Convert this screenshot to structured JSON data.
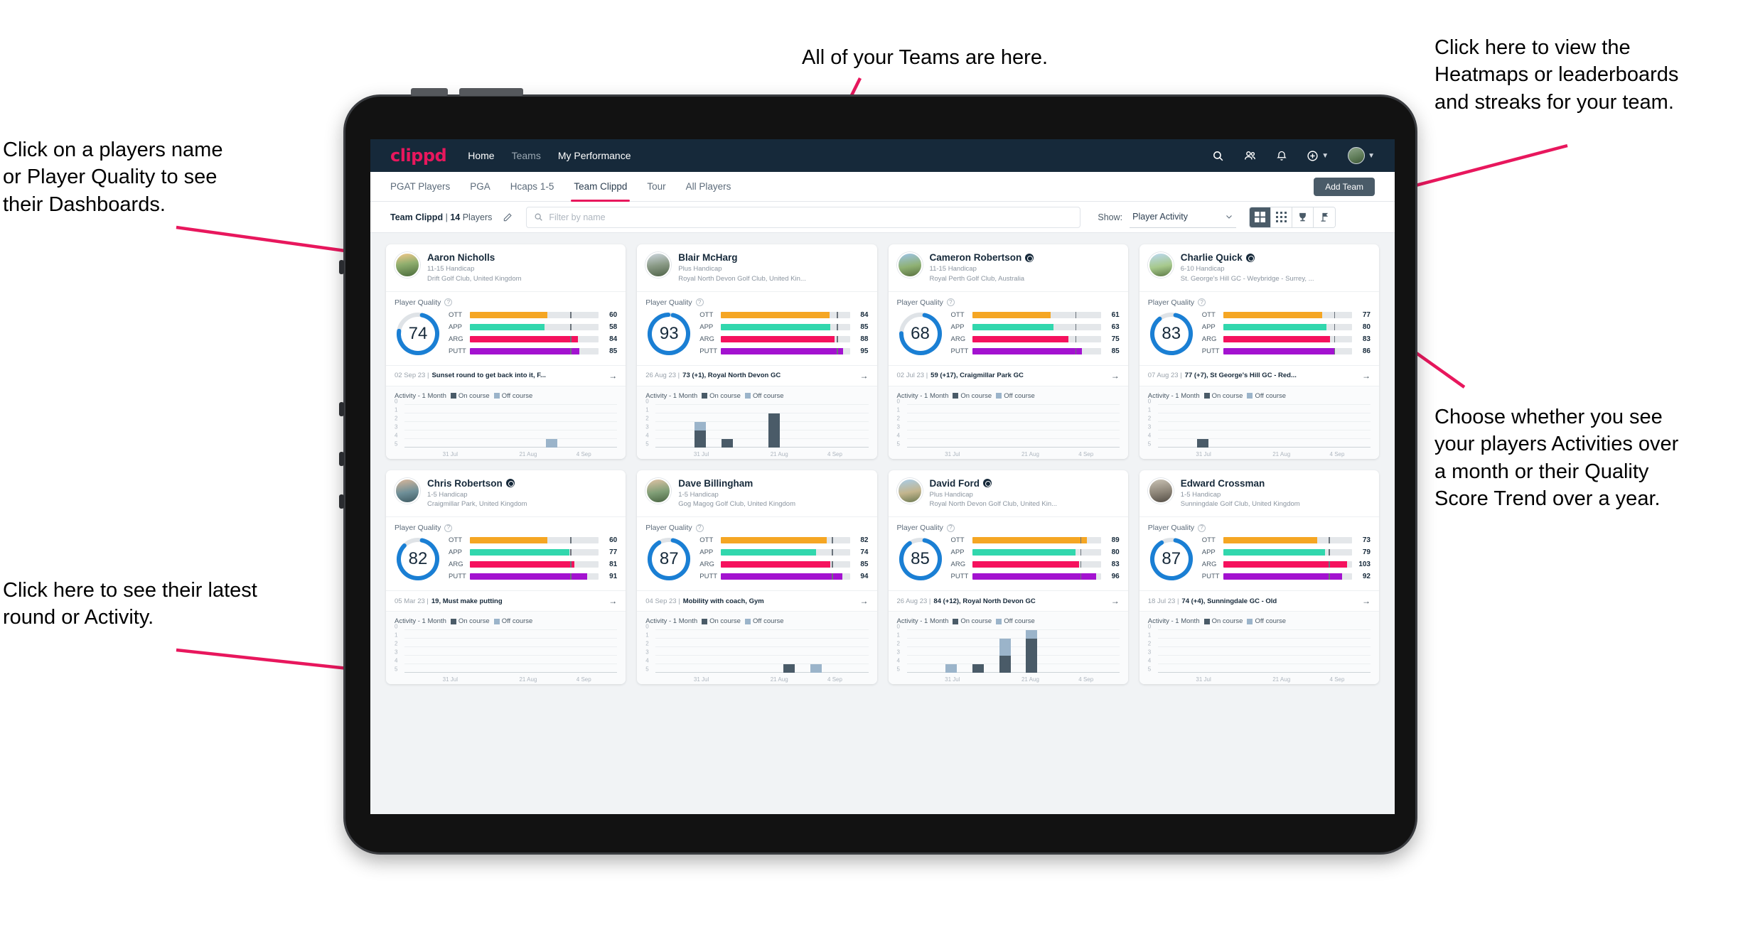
{
  "annotations": [
    {
      "id": "teams",
      "text": "All of your Teams are here."
    },
    {
      "id": "heatmaps",
      "text": "Click here to view the\nHeatmaps or leaderboards\nand streaks for your team."
    },
    {
      "id": "names",
      "text": "Click on a players name\nor Player Quality to see\ntheir Dashboards."
    },
    {
      "id": "activity",
      "text": "Choose whether you see\nyour players Activities over\na month or their Quality\nScore Trend over a year."
    },
    {
      "id": "latest",
      "text": "Click here to see their latest\nround or Activity."
    }
  ],
  "topnav": {
    "brand": "clippd",
    "links": [
      {
        "label": "Home",
        "active": true
      },
      {
        "label": "Teams",
        "active": false
      },
      {
        "label": "My Performance",
        "active": true
      }
    ],
    "icons": [
      "search-icon",
      "people-icon",
      "bell-icon",
      "plus-circle-icon",
      "avatar"
    ]
  },
  "subtabs": {
    "items": [
      {
        "label": "PGAT Players",
        "active": false
      },
      {
        "label": "PGA",
        "active": false
      },
      {
        "label": "Hcaps 1-5",
        "active": false
      },
      {
        "label": "Team Clippd",
        "active": true
      },
      {
        "label": "Tour",
        "active": false
      },
      {
        "label": "All Players",
        "active": false
      }
    ],
    "add_team_label": "Add Team"
  },
  "filterbar": {
    "team_name": "Team Clippd",
    "team_count": "14",
    "team_count_suffix": "Players",
    "separator": "|",
    "search_placeholder": "Filter by name",
    "show_label": "Show:",
    "show_value": "Player Activity",
    "view_modes": [
      "grid-large-icon",
      "grid-small-icon",
      "trophy-icon",
      "flag-icon"
    ],
    "active_view": "grid-large-icon"
  },
  "colors": {
    "accent_pink": "#e8175d",
    "nav_bg": "#16293a",
    "ott": "#f5a623",
    "app": "#31d7ad",
    "arg": "#f5125e",
    "putt": "#a312d0",
    "ring": "#1a7fd4",
    "on_course": "#4a5b68",
    "off_course": "#9bb4ca"
  },
  "chart_common": {
    "legend": [
      "On course",
      "Off course"
    ],
    "activity_title": "Activity - 1 Month",
    "yticks": [
      "5",
      "4",
      "3",
      "2",
      "1",
      "0"
    ],
    "ylim": [
      0,
      5
    ],
    "xticks": [
      "31 Jul",
      "21 Aug",
      "4 Sep"
    ]
  },
  "metric_labels": [
    "OTT",
    "APP",
    "ARG",
    "PUTT"
  ],
  "pq_label": "Player Quality",
  "players": [
    {
      "name": "Aaron Nicholls",
      "verified": false,
      "handicap": "11-15 Handicap",
      "club": "Drift Golf Club, United Kingdom",
      "quality": "74",
      "ring_pct": 74,
      "metrics": [
        {
          "label": "OTT",
          "value": "60",
          "fill": 60,
          "tick": 78
        },
        {
          "label": "APP",
          "value": "58",
          "fill": 58,
          "tick": 78
        },
        {
          "label": "ARG",
          "value": "84",
          "fill": 84,
          "tick": 78
        },
        {
          "label": "PUTT",
          "value": "85",
          "fill": 85,
          "tick": 78
        }
      ],
      "round_date": "02 Sep 23",
      "round_text": "Sunset round to get back into it, F...",
      "chart": {
        "type": "bar",
        "bars": [
          {
            "x": 68,
            "on": 0,
            "off": 1
          }
        ]
      }
    },
    {
      "name": "Blair McHarg",
      "verified": false,
      "handicap": "Plus Handicap",
      "club": "Royal North Devon Golf Club, United Kin...",
      "quality": "93",
      "ring_pct": 96,
      "metrics": [
        {
          "label": "OTT",
          "value": "84",
          "fill": 84,
          "tick": 90
        },
        {
          "label": "APP",
          "value": "85",
          "fill": 85,
          "tick": 90
        },
        {
          "label": "ARG",
          "value": "88",
          "fill": 88,
          "tick": 90
        },
        {
          "label": "PUTT",
          "value": "95",
          "fill": 95,
          "tick": 90
        }
      ],
      "round_date": "26 Aug 23",
      "round_text": "73 (+1), Royal North Devon GC",
      "chart": {
        "type": "bar",
        "bars": [
          {
            "x": 22,
            "on": 2,
            "off": 1
          },
          {
            "x": 34,
            "on": 1,
            "off": 0
          },
          {
            "x": 55,
            "on": 4,
            "off": 0
          }
        ]
      }
    },
    {
      "name": "Cameron Robertson",
      "verified": true,
      "handicap": "11-15 Handicap",
      "club": "Royal Perth Golf Club, Australia",
      "quality": "68",
      "ring_pct": 72,
      "metrics": [
        {
          "label": "OTT",
          "value": "61",
          "fill": 61,
          "tick": 80
        },
        {
          "label": "APP",
          "value": "63",
          "fill": 63,
          "tick": 80
        },
        {
          "label": "ARG",
          "value": "75",
          "fill": 75,
          "tick": 80
        },
        {
          "label": "PUTT",
          "value": "85",
          "fill": 85,
          "tick": 80
        }
      ],
      "round_date": "02 Jul 23",
      "round_text": "59 (+17), Craigmillar Park GC",
      "chart": {
        "type": "bar",
        "bars": []
      }
    },
    {
      "name": "Charlie Quick",
      "verified": true,
      "handicap": "6-10 Handicap",
      "club": "St. George's Hill GC - Weybridge - Surrey, ...",
      "quality": "83",
      "ring_pct": 86,
      "metrics": [
        {
          "label": "OTT",
          "value": "77",
          "fill": 77,
          "tick": 86
        },
        {
          "label": "APP",
          "value": "80",
          "fill": 80,
          "tick": 86
        },
        {
          "label": "ARG",
          "value": "83",
          "fill": 83,
          "tick": 86
        },
        {
          "label": "PUTT",
          "value": "86",
          "fill": 86,
          "tick": 86
        }
      ],
      "round_date": "07 Aug 23",
      "round_text": "77 (+7), St George's Hill GC - Red...",
      "chart": {
        "type": "bar",
        "bars": [
          {
            "x": 22,
            "on": 1,
            "off": 0
          }
        ]
      }
    },
    {
      "name": "Chris Robertson",
      "verified": true,
      "handicap": "1-5 Handicap",
      "club": "Craigmillar Park, United Kingdom",
      "quality": "82",
      "ring_pct": 84,
      "metrics": [
        {
          "label": "OTT",
          "value": "60",
          "fill": 60,
          "tick": 78
        },
        {
          "label": "APP",
          "value": "77",
          "fill": 77,
          "tick": 78
        },
        {
          "label": "ARG",
          "value": "81",
          "fill": 81,
          "tick": 78
        },
        {
          "label": "PUTT",
          "value": "91",
          "fill": 91,
          "tick": 78
        }
      ],
      "round_date": "05 Mar 23",
      "round_text": "19, Must make putting",
      "chart": {
        "type": "bar",
        "bars": []
      }
    },
    {
      "name": "Dave Billingham",
      "verified": false,
      "handicap": "1-5 Handicap",
      "club": "Gog Magog Golf Club, United Kingdom",
      "quality": "87",
      "ring_pct": 88,
      "metrics": [
        {
          "label": "OTT",
          "value": "82",
          "fill": 82,
          "tick": 86
        },
        {
          "label": "APP",
          "value": "74",
          "fill": 74,
          "tick": 86
        },
        {
          "label": "ARG",
          "value": "85",
          "fill": 85,
          "tick": 86
        },
        {
          "label": "PUTT",
          "value": "94",
          "fill": 94,
          "tick": 86
        }
      ],
      "round_date": "04 Sep 23",
      "round_text": "Mobility with coach, Gym",
      "chart": {
        "type": "bar",
        "bars": [
          {
            "x": 62,
            "on": 1,
            "off": 0
          },
          {
            "x": 74,
            "on": 0,
            "off": 1
          }
        ]
      }
    },
    {
      "name": "David Ford",
      "verified": true,
      "handicap": "Plus Handicap",
      "club": "Royal North Devon Golf Club, United Kin...",
      "quality": "85",
      "ring_pct": 87,
      "metrics": [
        {
          "label": "OTT",
          "value": "89",
          "fill": 89,
          "tick": 84
        },
        {
          "label": "APP",
          "value": "80",
          "fill": 80,
          "tick": 84
        },
        {
          "label": "ARG",
          "value": "83",
          "fill": 83,
          "tick": 84
        },
        {
          "label": "PUTT",
          "value": "96",
          "fill": 96,
          "tick": 84
        }
      ],
      "round_date": "26 Aug 23",
      "round_text": "84 (+12), Royal North Devon GC",
      "chart": {
        "type": "bar",
        "bars": [
          {
            "x": 22,
            "on": 0,
            "off": 1
          },
          {
            "x": 34,
            "on": 1,
            "off": 0
          },
          {
            "x": 46,
            "on": 2,
            "off": 2
          },
          {
            "x": 58,
            "on": 4,
            "off": 1
          }
        ]
      }
    },
    {
      "name": "Edward Crossman",
      "verified": false,
      "handicap": "1-5 Handicap",
      "club": "Sunningdale Golf Club, United Kingdom",
      "quality": "87",
      "ring_pct": 88,
      "metrics": [
        {
          "label": "OTT",
          "value": "73",
          "fill": 73,
          "tick": 82
        },
        {
          "label": "APP",
          "value": "79",
          "fill": 79,
          "tick": 82
        },
        {
          "label": "ARG",
          "value": "103",
          "fill": 96,
          "tick": 82
        },
        {
          "label": "PUTT",
          "value": "92",
          "fill": 92,
          "tick": 82
        }
      ],
      "round_date": "18 Jul 23",
      "round_text": "74 (+4), Sunningdale GC - Old",
      "chart": {
        "type": "bar",
        "bars": []
      }
    }
  ]
}
